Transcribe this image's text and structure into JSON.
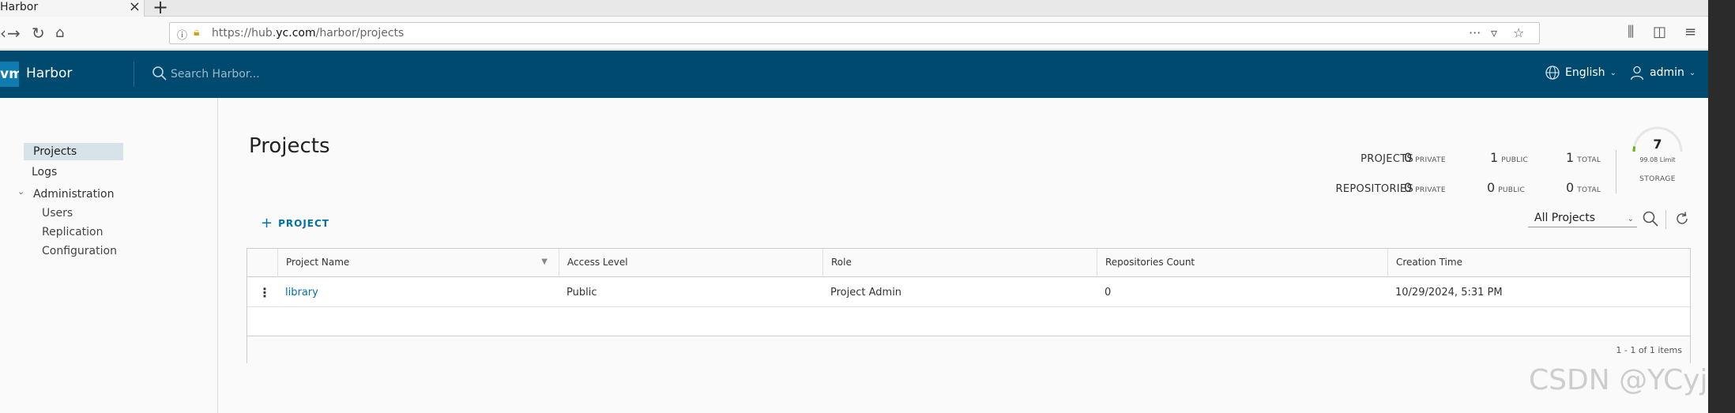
{
  "browser": {
    "tab_title": "Harbor",
    "new_tab": "+",
    "url_host": "https://hub.",
    "url_domain": "yc.com",
    "url_path": "/harbor/projects"
  },
  "header": {
    "logo_text": "vm",
    "app_title": "Harbor",
    "search_placeholder": "Search Harbor...",
    "language": "English",
    "user": "admin"
  },
  "sidebar": {
    "projects": "Projects",
    "logs": "Logs",
    "administration": "Administration",
    "users": "Users",
    "replication": "Replication",
    "configuration": "Configuration"
  },
  "main": {
    "title": "Projects",
    "summary": {
      "projects_label": "PROJECTS",
      "repositories_label": "REPOSITORIES",
      "projects_private": "0",
      "projects_public": "1",
      "projects_total": "1",
      "repos_private": "0",
      "repos_public": "0",
      "repos_total": "0",
      "private_label": "PRIVATE",
      "public_label": "PUBLIC",
      "total_label": "TOTAL",
      "storage_value": "7",
      "storage_limit": "99.08 Limit",
      "storage_label": "STORAGE",
      "storage_fraction": 0.07
    },
    "add_project": "PROJECT",
    "filter": "All Projects",
    "columns": [
      "Project Name",
      "Access Level",
      "Role",
      "Repositories Count",
      "Creation Time"
    ],
    "rows": [
      {
        "name": "library",
        "access": "Public",
        "role": "Project Admin",
        "repo_count": "0",
        "created": "10/29/2024, 5:31 PM"
      }
    ],
    "pagination": "1 - 1 of 1 items"
  },
  "watermark": "CSDN @YCyjs",
  "colors": {
    "header": "#004a70",
    "link": "#0072a3",
    "nav_active": "#d8e3e9"
  }
}
